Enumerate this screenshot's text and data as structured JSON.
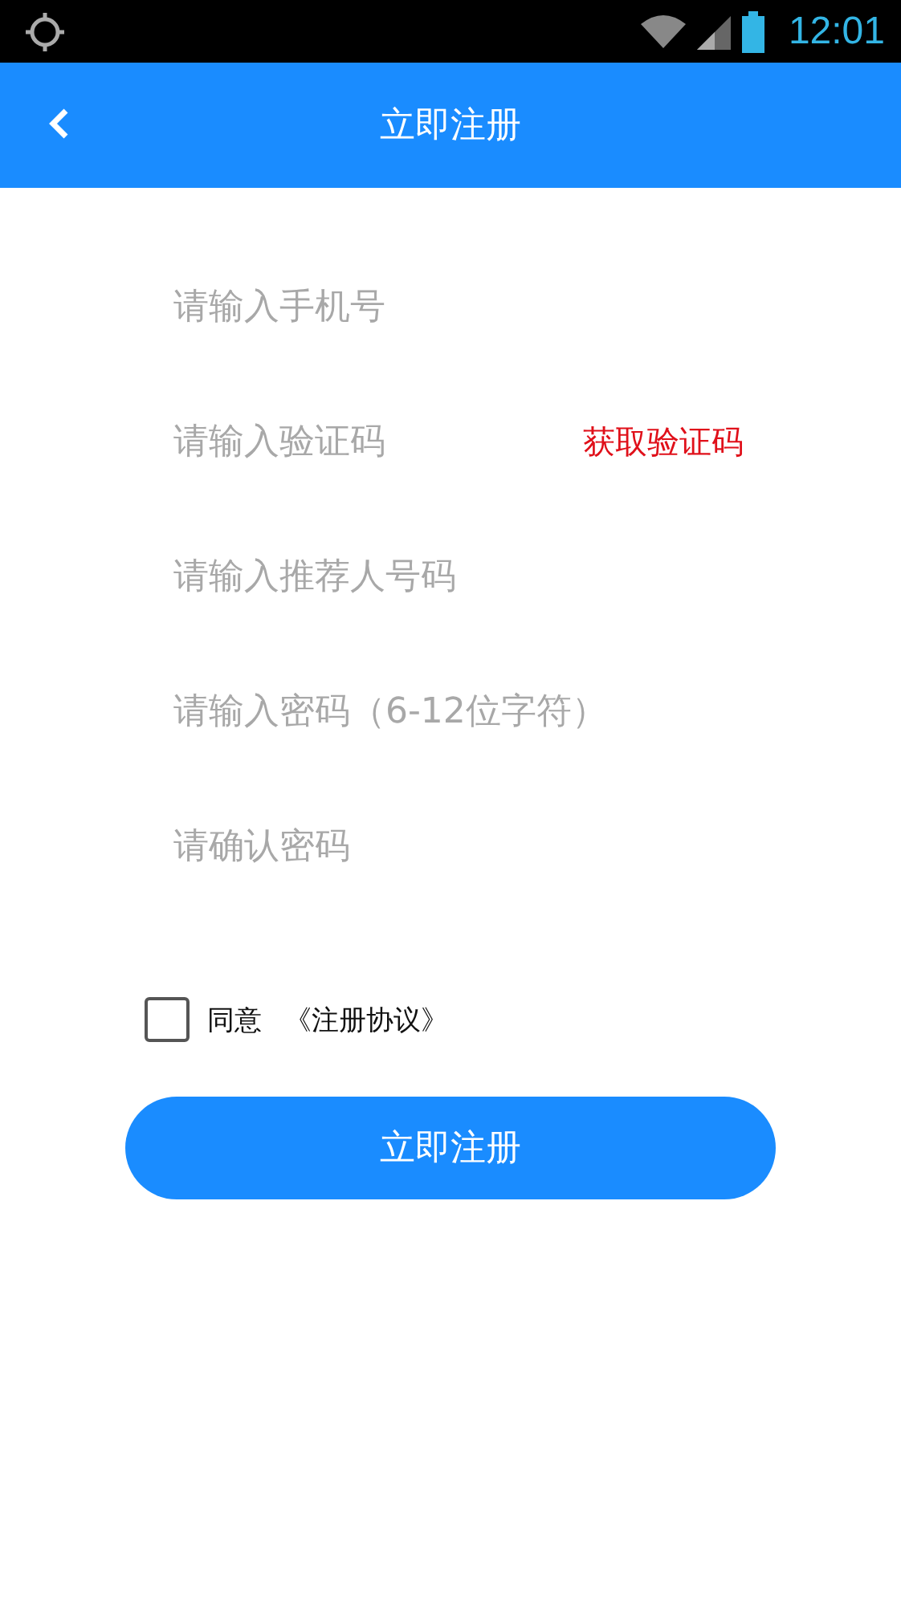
{
  "status_bar": {
    "time": "12:01"
  },
  "header": {
    "title": "立即注册"
  },
  "fields": [
    {
      "placeholder": "请输入手机号",
      "kind": "text"
    },
    {
      "placeholder": "请输入验证码",
      "kind": "code"
    },
    {
      "placeholder": "请输入推荐人号码",
      "kind": "text"
    },
    {
      "placeholder": "请输入密码（6-12位字符）",
      "kind": "password"
    },
    {
      "placeholder": "请确认密码",
      "kind": "password"
    }
  ],
  "get_code_button": "获取验证码",
  "agreement": {
    "checked": false,
    "agree_text": "同意",
    "link_text": "《注册协议》"
  },
  "submit_button": "立即注册"
}
